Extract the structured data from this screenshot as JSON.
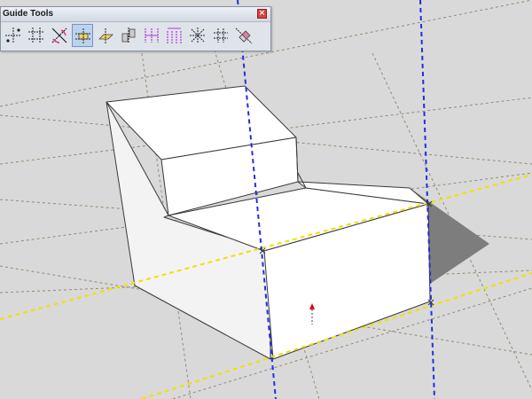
{
  "toolbar": {
    "title": "Guide Tools",
    "close_glyph": "×",
    "buttons": [
      {
        "name": "perpendicular-guides-icon",
        "active": false
      },
      {
        "name": "guide-grid-icon",
        "active": false
      },
      {
        "name": "diagonal-guide-icon",
        "active": false
      },
      {
        "name": "edge-guide-icon",
        "active": true
      },
      {
        "name": "plane-guide-icon",
        "active": false
      },
      {
        "name": "mirror-guide-icon",
        "active": false
      },
      {
        "name": "divide-guides-icon",
        "active": false
      },
      {
        "name": "array-guides-icon",
        "active": false
      },
      {
        "name": "radial-guides-icon",
        "active": false
      },
      {
        "name": "grid-hash-icon",
        "active": false
      },
      {
        "name": "erase-guides-icon",
        "active": false
      }
    ]
  },
  "colors": {
    "viewport_bg": "#d9d9d9",
    "face_white": "#ffffff",
    "shadow": "#7d7d7d",
    "guide_blue": "#1f2fe0",
    "guide_yellow": "#efe100",
    "guide_gray": "#938b73",
    "cursor_red": "#e00000"
  }
}
